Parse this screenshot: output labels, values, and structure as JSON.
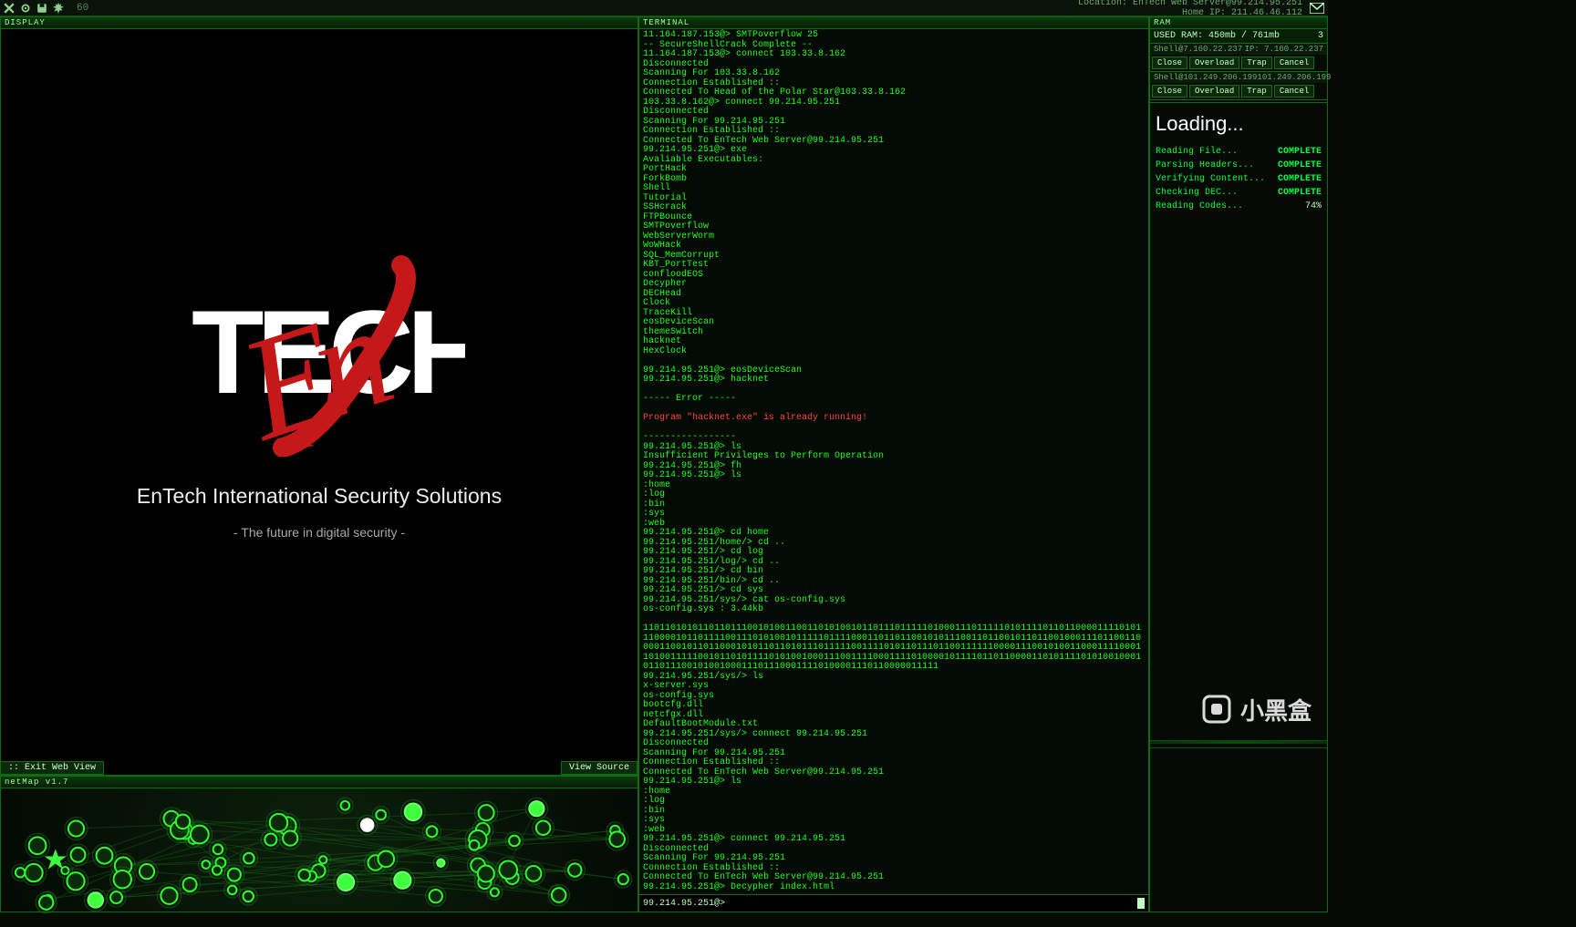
{
  "topbar": {
    "fps": "60",
    "location_label": "Location: EnTech Web Server@99.214.95.251",
    "home_ip_label": "Home IP: 211.46.46.112"
  },
  "display": {
    "title": "DISPLAY",
    "company": "EnTech International Security Solutions",
    "tagline": "- The future in digital security -",
    "exit_btn": ":: Exit Web View",
    "source_btn": "View Source"
  },
  "netmap": {
    "title": "netMap v1.7"
  },
  "terminal": {
    "title": "TERMINAL",
    "lines": [
      {
        "t": "11.164.187.153@> SMTPoverflow 25"
      },
      {
        "t": "-- SecureShellCrack Complete --"
      },
      {
        "t": "11.164.187.153@> connect 103.33.8.162"
      },
      {
        "t": "Disconnected"
      },
      {
        "t": "Scanning For 103.33.8.162"
      },
      {
        "t": "Connection Established ::"
      },
      {
        "t": "Connected To Head of the Polar Star@103.33.8.162"
      },
      {
        "t": "103.33.8.162@> connect 99.214.95.251"
      },
      {
        "t": "Disconnected"
      },
      {
        "t": "Scanning For 99.214.95.251"
      },
      {
        "t": "Connection Established ::"
      },
      {
        "t": "Connected To EnTech Web Server@99.214.95.251"
      },
      {
        "t": "99.214.95.251@> exe"
      },
      {
        "t": "Avaliable Executables:"
      },
      {
        "t": "PortHack"
      },
      {
        "t": "ForkBomb"
      },
      {
        "t": "Shell"
      },
      {
        "t": "Tutorial"
      },
      {
        "t": "SSHcrack"
      },
      {
        "t": "FTPBounce"
      },
      {
        "t": "SMTPoverflow"
      },
      {
        "t": "WebServerWorm"
      },
      {
        "t": "WoWHack"
      },
      {
        "t": "SQL_MemCorrupt"
      },
      {
        "t": "KBT_PortTest"
      },
      {
        "t": "confloodEOS"
      },
      {
        "t": "Decypher"
      },
      {
        "t": "DECHead"
      },
      {
        "t": "Clock"
      },
      {
        "t": "TraceKill"
      },
      {
        "t": "eosDeviceScan"
      },
      {
        "t": "themeSwitch"
      },
      {
        "t": "hacknet"
      },
      {
        "t": "HexClock"
      },
      {
        "t": " "
      },
      {
        "t": "99.214.95.251@> eosDeviceScan"
      },
      {
        "t": "99.214.95.251@> hacknet"
      },
      {
        "t": " "
      },
      {
        "t": "----- Error -----",
        "c": "term-div"
      },
      {
        "t": " "
      },
      {
        "t": "Program \"hacknet.exe\" is already running!",
        "c": "term-err"
      },
      {
        "t": " "
      },
      {
        "t": "-----------------",
        "c": "term-div"
      },
      {
        "t": "99.214.95.251@> ls"
      },
      {
        "t": "Insufficient Privileges to Perform Operation"
      },
      {
        "t": "99.214.95.251@> fh"
      },
      {
        "t": "99.214.95.251@> ls"
      },
      {
        "t": ":home"
      },
      {
        "t": ":log"
      },
      {
        "t": ":bin"
      },
      {
        "t": ":sys"
      },
      {
        "t": ":web"
      },
      {
        "t": "99.214.95.251@> cd home"
      },
      {
        "t": "99.214.95.251/home/> cd .."
      },
      {
        "t": "99.214.95.251/> cd log"
      },
      {
        "t": "99.214.95.251/log/> cd .."
      },
      {
        "t": "99.214.95.251/> cd bin"
      },
      {
        "t": "99.214.95.251/bin/> cd .."
      },
      {
        "t": "99.214.95.251/> cd sys"
      },
      {
        "t": "99.214.95.251/sys/> cat os-config.sys"
      },
      {
        "t": "os-config.sys : 3.44kb"
      },
      {
        "t": " "
      },
      {
        "t": "1101101010110110111001010011001101010010110111011111010001110111110101111011011000011110101110000101101111001110101001011111011110001101101100101011100110110010110110010001110110011000011001011011000101011011010111011111001111010110111011001111110000111001010011000111100011010011111001011010111101010010001110011110001111010000101111011011000011010111101010010001011011100101001000111011100011110100001110110000011111"
      },
      {
        "t": "99.214.95.251/sys/> ls"
      },
      {
        "t": "x-server.sys"
      },
      {
        "t": "os-config.sys"
      },
      {
        "t": "bootcfg.dll"
      },
      {
        "t": "netcfgx.dll"
      },
      {
        "t": "DefaultBootModule.txt"
      },
      {
        "t": "99.214.95.251/sys/> connect 99.214.95.251"
      },
      {
        "t": "Disconnected"
      },
      {
        "t": "Scanning For 99.214.95.251"
      },
      {
        "t": "Connection Established ::"
      },
      {
        "t": "Connected To EnTech Web Server@99.214.95.251"
      },
      {
        "t": "99.214.95.251@> ls"
      },
      {
        "t": ":home"
      },
      {
        "t": ":log"
      },
      {
        "t": ":bin"
      },
      {
        "t": ":sys"
      },
      {
        "t": ":web"
      },
      {
        "t": "99.214.95.251@> connect 99.214.95.251"
      },
      {
        "t": "Disconnected"
      },
      {
        "t": "Scanning For 99.214.95.251"
      },
      {
        "t": "Connection Established ::"
      },
      {
        "t": "Connected To EnTech Web Server@99.214.95.251"
      },
      {
        "t": "99.214.95.251@> Decypher index.html"
      }
    ],
    "prompt": "99.214.95.251@> ",
    "input_value": ""
  },
  "ram": {
    "title": "RAM",
    "used_label": "USED RAM: 450mb / 761mb",
    "used_count": "3",
    "shells": [
      {
        "left": "Shell@7.160.22.237",
        "right": "IP: 7.160.22.237"
      },
      {
        "left": "Shell@101.249.206.199",
        "right": "101.249.206.199"
      }
    ],
    "shell_btns": {
      "close": "Close",
      "overload": "Overload",
      "trap": "Trap",
      "cancel": "Cancel"
    },
    "loading": {
      "title": "Loading...",
      "rows": [
        {
          "label": "Reading File...",
          "status": "COMPLETE"
        },
        {
          "label": "Parsing Headers...",
          "status": "COMPLETE"
        },
        {
          "label": "Verifying Content...",
          "status": "COMPLETE"
        },
        {
          "label": "Checking DEC...",
          "status": "COMPLETE"
        },
        {
          "label": "Reading Codes...",
          "status": "74%"
        }
      ]
    }
  },
  "watermark": "小黑盒"
}
